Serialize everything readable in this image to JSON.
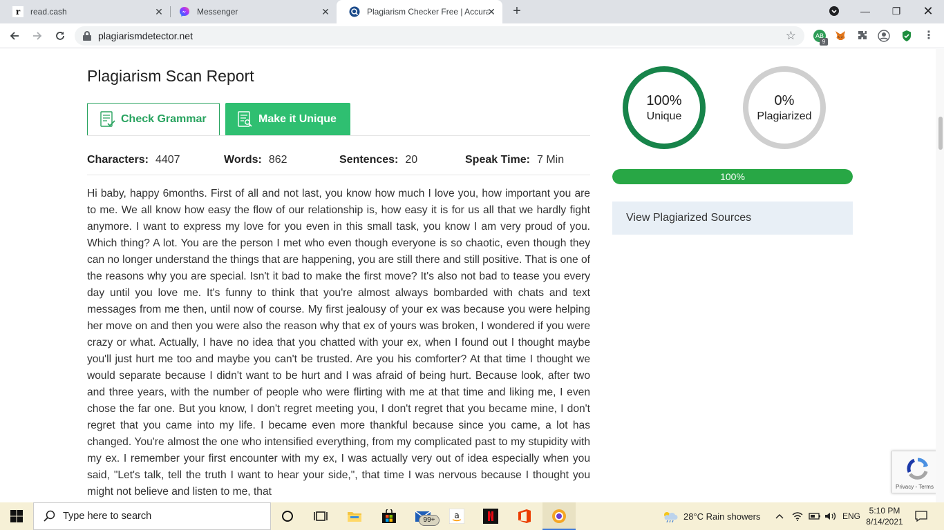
{
  "browser": {
    "tabs": [
      {
        "title": "read.cash",
        "favicon": "r"
      },
      {
        "title": "Messenger",
        "favicon": "messenger-icon"
      },
      {
        "title": "Plagiarism Checker Free | Accura",
        "favicon": "plagiarism-icon"
      }
    ],
    "url": "plagiarismdetector.net",
    "extension_badge": "9"
  },
  "report": {
    "title": "Plagiarism Scan Report",
    "check_grammar_label": "Check Grammar",
    "make_unique_label": "Make it Unique",
    "stats": {
      "characters_label": "Characters:",
      "characters_value": "4407",
      "words_label": "Words:",
      "words_value": "862",
      "sentences_label": "Sentences:",
      "sentences_value": "20",
      "speak_label": "Speak Time:",
      "speak_value": "7 Min"
    },
    "content": "Hi baby, happy 6months. First of all and not last, you know how much I love you, how important you are to me. We all know how easy the flow of our relationship is, how easy it is for us all that we hardly fight anymore. I want to express my love for you even in this small task, you know I am very proud of you. Which thing? A lot. You are the person I met who even though everyone is so chaotic, even though they can no longer understand the things that are happening, you are still there and still positive. That is one of the reasons why you are special. Isn't it bad to make the first move? It's also not bad to tease you every day until you love me. It's funny to think that you're almost always bombarded with chats and text messages from me then, until now of course. My first jealousy of your ex was because you were helping her move on and then you were also the reason why that ex of yours was broken, I wondered if you were crazy or what. Actually, I have no idea that you chatted with your ex, when I found out I thought maybe you'll just hurt me too and maybe you can't be trusted. Are you his comforter? At that time I thought we would separate because I didn't want to be hurt and I was afraid of being hurt. Because look, after two and three years, with the number of people who were flirting with me at that time and liking me, I even chose the far one. But you know, I don't regret meeting you, I don't regret that you became mine, I don't regret that you came into my life. I became even more thankful because since you came, a lot has changed. You're almost the one who intensified everything, from my complicated past to my stupidity with my ex. I remember your first encounter with my ex, I was actually very out of idea especially when you said, \"Let's talk, tell the truth I want to hear your side,\", that time I was nervous because I thought you might not believe and listen to me, that"
  },
  "results": {
    "unique_pct": "100%",
    "unique_label": "Unique",
    "plagiarized_pct": "0%",
    "plagiarized_label": "Plagiarized",
    "progress_value": 100,
    "progress_label": "100%",
    "sources_label": "View Plagiarized Sources",
    "colors": {
      "unique": "#17844a",
      "plagiarized": "#cfcfcf",
      "progress": "#28a745"
    }
  },
  "recaptcha": {
    "terms": "Privacy - Terms"
  },
  "taskbar": {
    "search_placeholder": "Type here to search",
    "mail_badge": "99+",
    "weather": "28°C  Rain showers",
    "language": "ENG",
    "time": "5:10 PM",
    "date": "8/14/2021"
  }
}
